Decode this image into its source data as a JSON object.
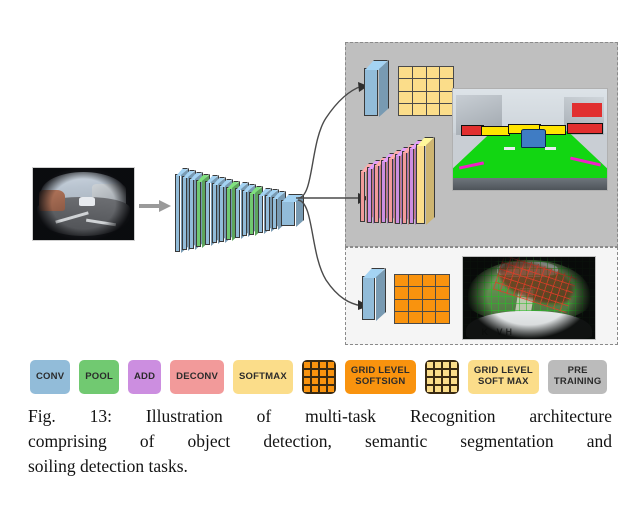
{
  "figure": {
    "caption": "Fig. 13: Illustration of multi-task Recognition architecture comprising of object detection, semantic segmentation and soiling detection tasks.",
    "caption_lines": [
      "Fig. 13: Illustration of multi-task Recognition architecture",
      "comprising of object detection, semantic segmentation and",
      "soiling detection tasks."
    ],
    "label": "Fig. 13"
  },
  "diagram": {
    "input": {
      "name": "fisheye-camera-input",
      "description": "Fisheye camera image of a road scene"
    },
    "encoder": {
      "name": "shared-encoder",
      "description": "Tapering stack of convolution and pooling layers",
      "layers": [
        {
          "type": "CONV",
          "color": "#92bcd9"
        },
        {
          "type": "CONV",
          "color": "#92bcd9"
        },
        {
          "type": "CONV",
          "color": "#92bcd9"
        },
        {
          "type": "POOL",
          "color": "#71c971"
        },
        {
          "type": "CONV",
          "color": "#92bcd9"
        },
        {
          "type": "CONV",
          "color": "#92bcd9"
        },
        {
          "type": "CONV",
          "color": "#92bcd9"
        },
        {
          "type": "POOL",
          "color": "#71c971"
        },
        {
          "type": "CONV",
          "color": "#92bcd9"
        },
        {
          "type": "CONV",
          "color": "#92bcd9"
        },
        {
          "type": "POOL",
          "color": "#71c971"
        },
        {
          "type": "CONV",
          "color": "#92bcd9"
        },
        {
          "type": "CONV",
          "color": "#92bcd9"
        },
        {
          "type": "CONV",
          "color": "#92bcd9"
        }
      ]
    },
    "branches": [
      {
        "name": "object-detection",
        "region": "detection-and-segmentation",
        "head": [
          {
            "type": "CONV",
            "color": "#92bcd9"
          }
        ],
        "grid": {
          "rows": 4,
          "cols": 4,
          "color": "#fbdd8a",
          "label": "GRID LEVEL SOFT MAX"
        }
      },
      {
        "name": "semantic-segmentation",
        "region": "detection-and-segmentation",
        "head": [
          {
            "type": "DECONV",
            "color": "#f29a9a"
          },
          {
            "type": "ADD",
            "color": "#cc8ee0"
          },
          {
            "type": "DECONV",
            "color": "#f29a9a"
          },
          {
            "type": "ADD",
            "color": "#cc8ee0"
          },
          {
            "type": "DECONV",
            "color": "#f29a9a"
          },
          {
            "type": "ADD",
            "color": "#cc8ee0"
          },
          {
            "type": "DECONV",
            "color": "#f29a9a"
          },
          {
            "type": "ADD",
            "color": "#cc8ee0"
          },
          {
            "type": "SOFTMAX",
            "color": "#fbdd8a"
          }
        ]
      },
      {
        "name": "soiling-detection",
        "region": "soiling",
        "head": [
          {
            "type": "CONV",
            "color": "#92bcd9"
          }
        ],
        "grid": {
          "rows": 4,
          "cols": 4,
          "color": "#f9930e",
          "label": "GRID LEVEL SOFTSIGN"
        }
      }
    ],
    "outputs": [
      {
        "name": "segmentation-output-image",
        "description": "Road scene with green road segmentation, magenta lane markings and yellow/red detection boxes"
      },
      {
        "name": "soiling-output-image",
        "description": "Soiled fisheye image overlaid with green and red detection grid"
      }
    ],
    "regions": [
      {
        "name": "detection-and-segmentation-region",
        "background": "#bfbfbf"
      },
      {
        "name": "soiling-region",
        "background": "#f5f5f5"
      }
    ]
  },
  "legend": {
    "items": [
      {
        "label": "CONV",
        "color": "#92bcd9",
        "kind": "box"
      },
      {
        "label": "POOL",
        "color": "#71c971",
        "kind": "box"
      },
      {
        "label": "ADD",
        "color": "#cc8ee0",
        "kind": "box"
      },
      {
        "label": "DECONV",
        "color": "#f29a9a",
        "kind": "box"
      },
      {
        "label": "SOFTMAX",
        "color": "#fbdd8a",
        "kind": "box"
      },
      {
        "label": "",
        "color": "#f9930e",
        "kind": "grid"
      },
      {
        "label": "GRID LEVEL\nSOFTSIGN",
        "color": "#f9930e",
        "kind": "box"
      },
      {
        "label": "",
        "color": "#fbdd8a",
        "kind": "grid"
      },
      {
        "label": "GRID LEVEL\nSOFT MAX",
        "color": "#fbdd8a",
        "kind": "box"
      },
      {
        "label": "PRE\nTRAINING",
        "color": "#bbbbbb",
        "kind": "box"
      }
    ]
  },
  "colors": {
    "conv": "#92bcd9",
    "pool": "#71c971",
    "add": "#cc8ee0",
    "deconv": "#f29a9a",
    "softmax": "#fbdd8a",
    "grid_softsign": "#f9930e",
    "pre_training": "#bbbbbb",
    "region_dark": "#bfbfbf",
    "region_light": "#f5f5f5",
    "page_background": "#ffffff",
    "text": "#131313"
  }
}
